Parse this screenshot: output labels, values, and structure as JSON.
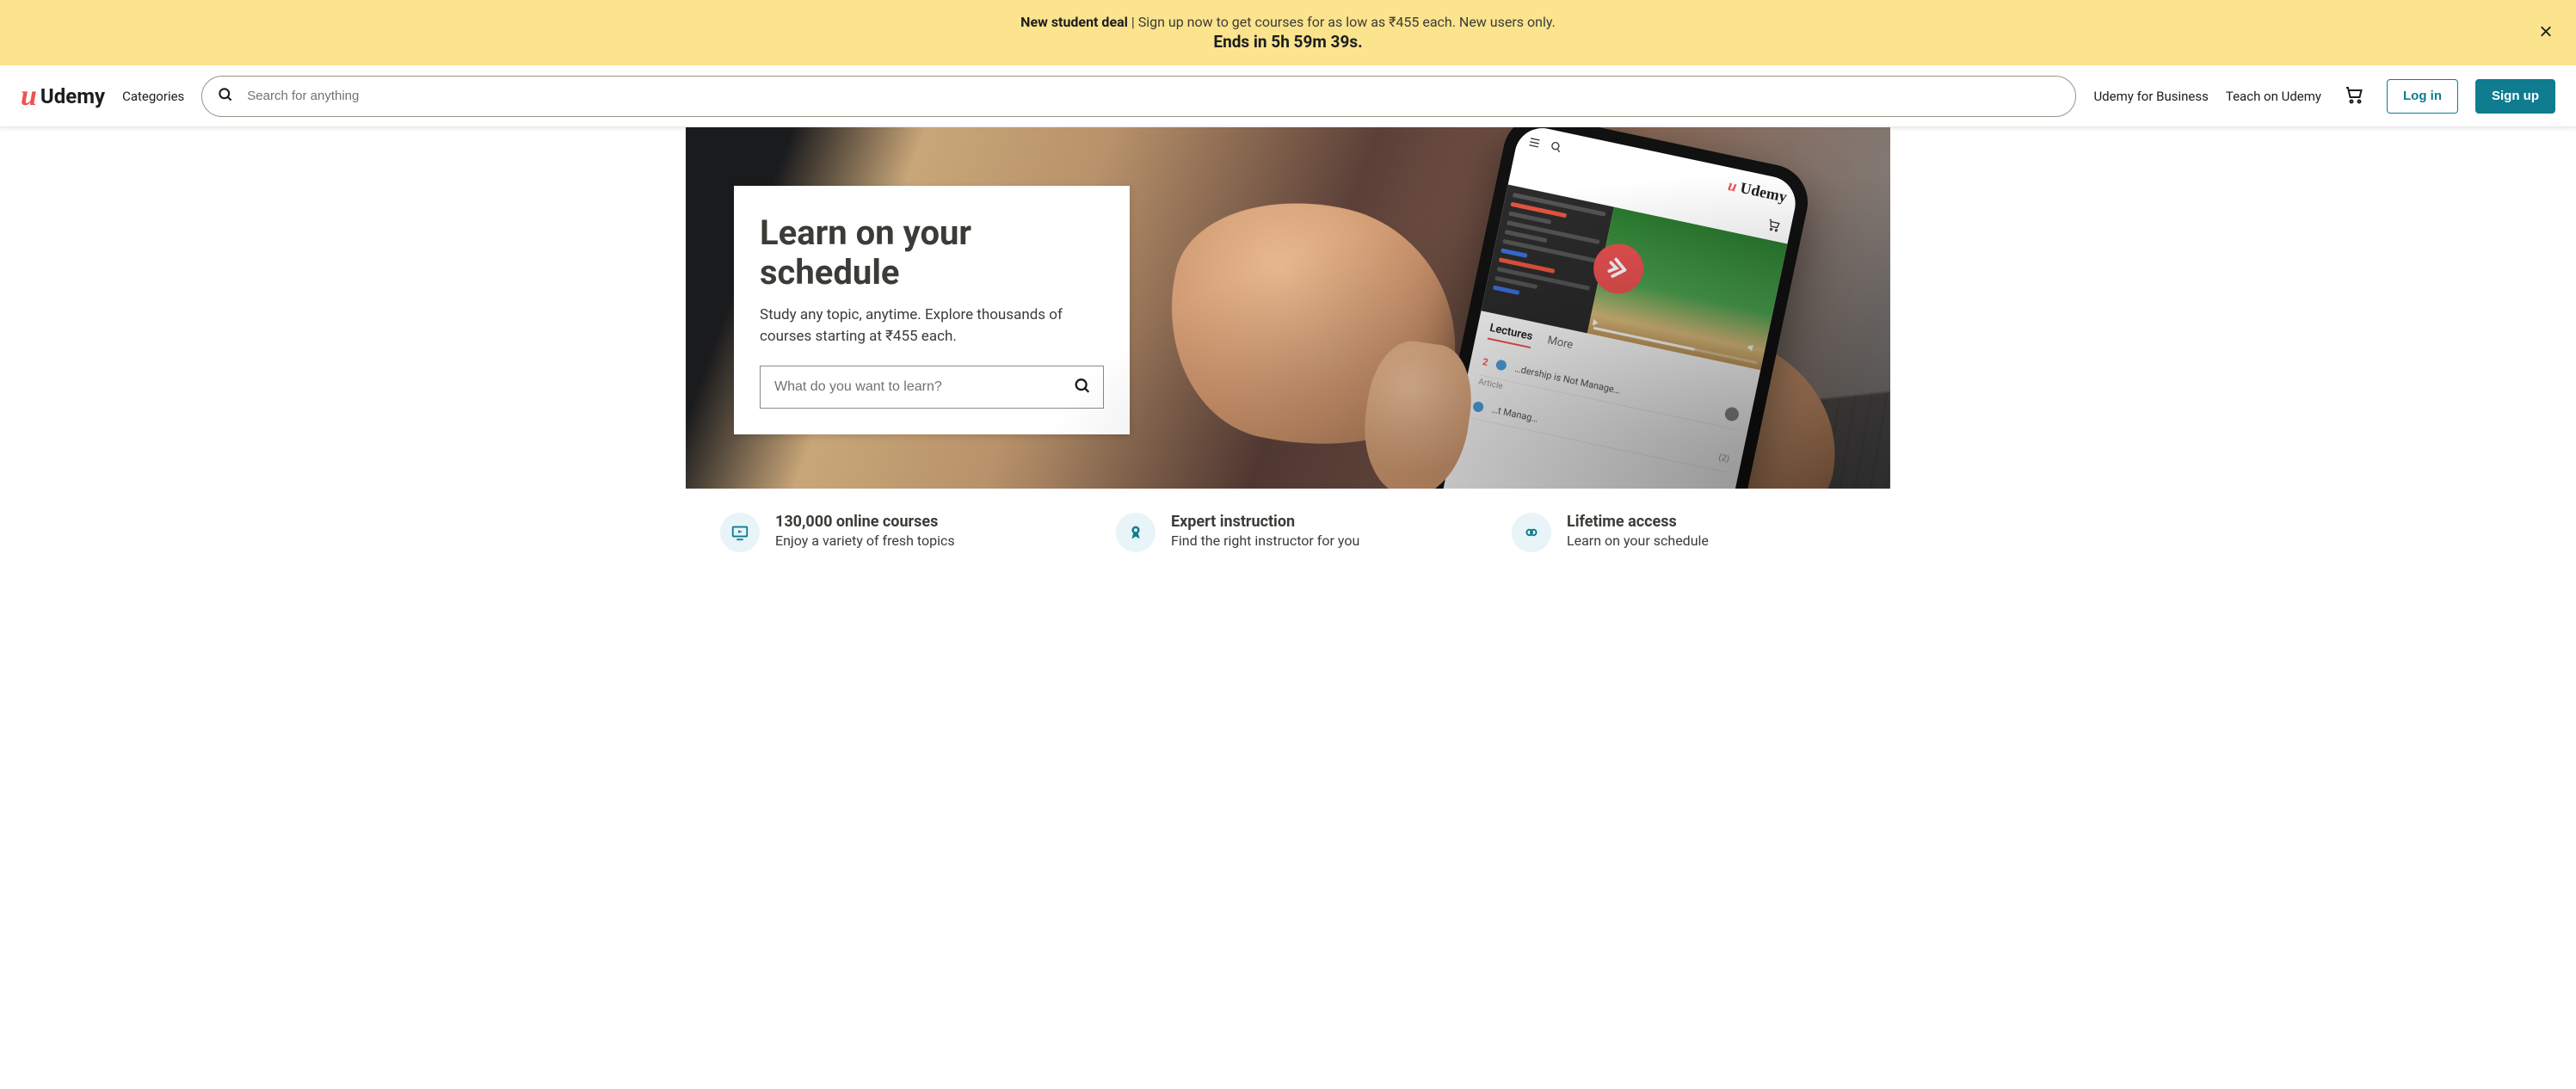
{
  "promo": {
    "bold_prefix": "New student deal",
    "separator": " | ",
    "text": "Sign up now to get courses for as low as ₹455 each. New users only.",
    "ends_prefix": "Ends in ",
    "countdown": "5h 59m 39s."
  },
  "header": {
    "logo_text": "Udemy",
    "categories": "Categories",
    "search_placeholder": "Search for anything",
    "business": "Udemy for Business",
    "teach": "Teach on Udemy",
    "login": "Log in",
    "signup": "Sign up"
  },
  "hero": {
    "title": "Learn on your schedule",
    "subtitle": "Study any topic, anytime. Explore thousands of courses starting at ₹455 each.",
    "search_placeholder": "What do you want to learn?"
  },
  "phone": {
    "logo": "Udemy",
    "tab1": "Lectures",
    "tab2": "More",
    "item1": "…dership is Not Manage…",
    "item1_sub": "Article",
    "item2": "…t Manag…",
    "num": "2"
  },
  "features": [
    {
      "title": "130,000 online courses",
      "sub": "Enjoy a variety of fresh topics"
    },
    {
      "title": "Expert instruction",
      "sub": "Find the right instructor for you"
    },
    {
      "title": "Lifetime access",
      "sub": "Learn on your schedule"
    }
  ],
  "colors": {
    "brand_red": "#ec5252",
    "brand_teal": "#0f7c90",
    "banner_bg": "#fbe48d"
  }
}
